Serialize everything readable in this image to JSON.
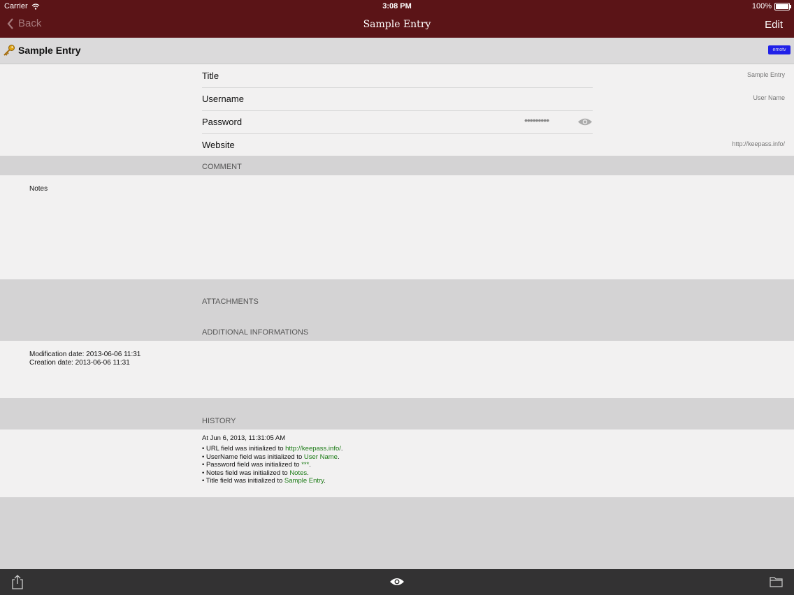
{
  "status_bar": {
    "carrier": "Carrier",
    "time": "3:08 PM",
    "battery": "100%"
  },
  "nav": {
    "back_label": "Back",
    "title": "Sample Entry",
    "edit_label": "Edit"
  },
  "entry": {
    "title": "Sample Entry",
    "badge": "emotv"
  },
  "fields": [
    {
      "label": "Title",
      "value": "Sample Entry"
    },
    {
      "label": "Username",
      "value": "User Name"
    },
    {
      "label": "Password",
      "value": "•••••••••"
    },
    {
      "label": "Website",
      "value": "http://keepass.info/"
    }
  ],
  "comment": {
    "heading": "COMMENT",
    "text": "Notes"
  },
  "attachments": {
    "heading": "ATTACHMENTS"
  },
  "additional": {
    "heading": "ADDITIONAL INFORMATIONS",
    "modification": "Modification date: 2013-06-06 11:31",
    "creation": "Creation date: 2013-06-06 11:31"
  },
  "history": {
    "heading": "HISTORY",
    "timestamp": "At Jun 6, 2013, 11:31:05 AM",
    "items": [
      {
        "prefix": "• URL field was initialized to ",
        "value": "http://keepass.info/",
        "suffix": "."
      },
      {
        "prefix": "• UserName field was initialized to ",
        "value": "User Name",
        "suffix": "."
      },
      {
        "prefix": "• Password field was initialized to ",
        "value": "***",
        "suffix": "."
      },
      {
        "prefix": "• Notes field was initialized to ",
        "value": "Notes",
        "suffix": "."
      },
      {
        "prefix": "• Title field was initialized to ",
        "value": "Sample Entry",
        "suffix": "."
      }
    ]
  },
  "toolbar": {
    "icons": [
      "share-icon",
      "eye-icon",
      "folder-icon"
    ]
  },
  "colors": {
    "nav_bg": "#5b1417",
    "toolbar_bg": "#333233",
    "badge": "#2020e8",
    "history_value": "#1a7a14"
  }
}
